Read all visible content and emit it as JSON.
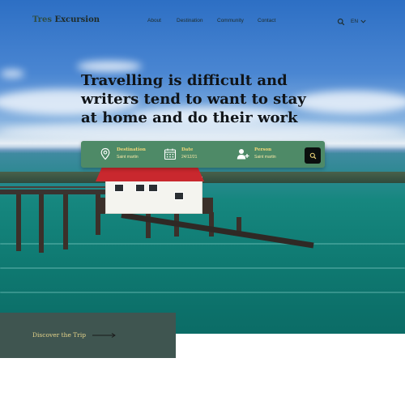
{
  "brand": {
    "part1": "Tres ",
    "part2": "Excursion"
  },
  "nav": {
    "items": [
      {
        "label": "About"
      },
      {
        "label": "Destination"
      },
      {
        "label": "Community"
      },
      {
        "label": "Contact"
      }
    ],
    "search_icon": "search-icon",
    "language": "EN"
  },
  "hero": {
    "headline": "Travelling is difficult and writers tend to want to stay at home and do their work"
  },
  "search": {
    "destination": {
      "label": "Destination",
      "value": "Saint martin",
      "icon": "location-pin-icon"
    },
    "date": {
      "label": "Date",
      "value": "24/12/21",
      "icon": "calendar-icon"
    },
    "person": {
      "label": "Person",
      "value": "Saint martin",
      "icon": "add-person-icon"
    },
    "button_icon": "search-icon"
  },
  "cta": {
    "label": "Discover the Trip",
    "icon": "arrow-right-icon"
  },
  "colors": {
    "search_bar": "#4e8a67",
    "accent_text": "#f2d97a",
    "cta_box": "#3f5550",
    "roof": "#c9282e"
  }
}
